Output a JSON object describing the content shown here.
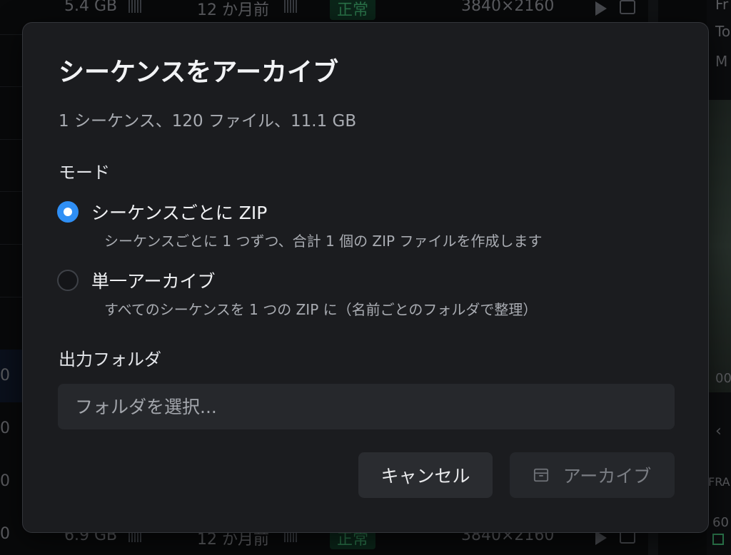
{
  "background": {
    "rows": [
      {
        "size": "5.4 GB",
        "date": "12 か月前",
        "status": "正常",
        "resolution": "3840×2160"
      },
      {
        "size": "6.9 GB",
        "date": "12 か月前",
        "status": "正常",
        "resolution": "3840×2160"
      }
    ],
    "left_cells": [
      "0",
      "0",
      "0",
      "0"
    ],
    "right_labels": [
      "Fr",
      "To",
      "M"
    ],
    "right_bottom": [
      "00",
      "FRA",
      "60"
    ]
  },
  "dialog": {
    "title": "シーケンスをアーカイブ",
    "summary": "1 シーケンス、120 ファイル、11.1 GB",
    "mode_label": "モード",
    "options": [
      {
        "label": "シーケンスごとに ZIP",
        "description": "シーケンスごとに 1 つずつ、合計 1 個の ZIP ファイルを作成します",
        "checked": true
      },
      {
        "label": "単一アーカイブ",
        "description": "すべてのシーケンスを 1 つの ZIP に（名前ごとのフォルダで整理）",
        "checked": false
      }
    ],
    "output_label": "出力フォルダ",
    "folder_placeholder": "フォルダを選択...",
    "cancel_label": "キャンセル",
    "archive_label": "アーカイブ"
  },
  "colors": {
    "accent": "#2f8ff5",
    "status_ok": "#3fae6f"
  }
}
